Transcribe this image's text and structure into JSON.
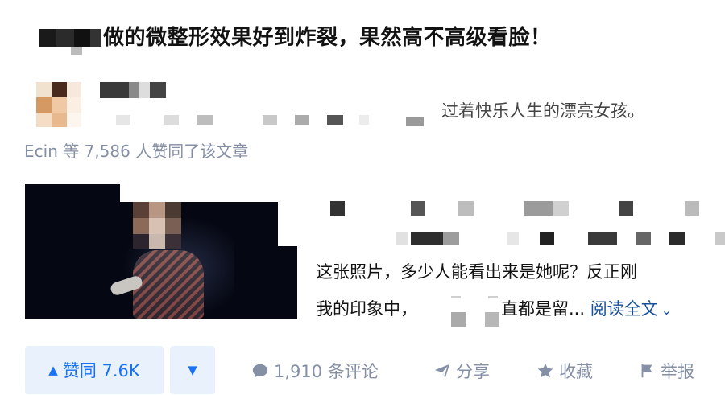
{
  "article": {
    "title": "做的微整形效果好到炸裂，果然高不高级看脸！"
  },
  "author": {
    "bio": "过着快乐人生的漂亮女孩。"
  },
  "voters": {
    "summary": "Ecin 等 7,586 人赞同了该文章"
  },
  "excerpt": {
    "line1": "这张照片，多少人能看出来是她呢？反正刚",
    "line2_before": "我的印象中，",
    "line2_after": "直都是留...",
    "read_more": "阅读全文"
  },
  "actions": {
    "vote_up": "赞同 7.6K",
    "comments": "1,910 条评论",
    "share": "分享",
    "favorite": "收藏",
    "report": "举报"
  },
  "colors": {
    "brand_blue": "#1772f6",
    "vote_bg": "#e8f1fc",
    "meta_gray": "#8590a6",
    "link_blue": "#175199"
  },
  "icons": {
    "vote_up": "triangle-up-icon",
    "vote_down": "triangle-down-icon",
    "comments": "comment-bubble-icon",
    "share": "paper-plane-icon",
    "favorite": "star-icon",
    "report": "flag-icon",
    "read_more": "chevron-down-icon"
  }
}
